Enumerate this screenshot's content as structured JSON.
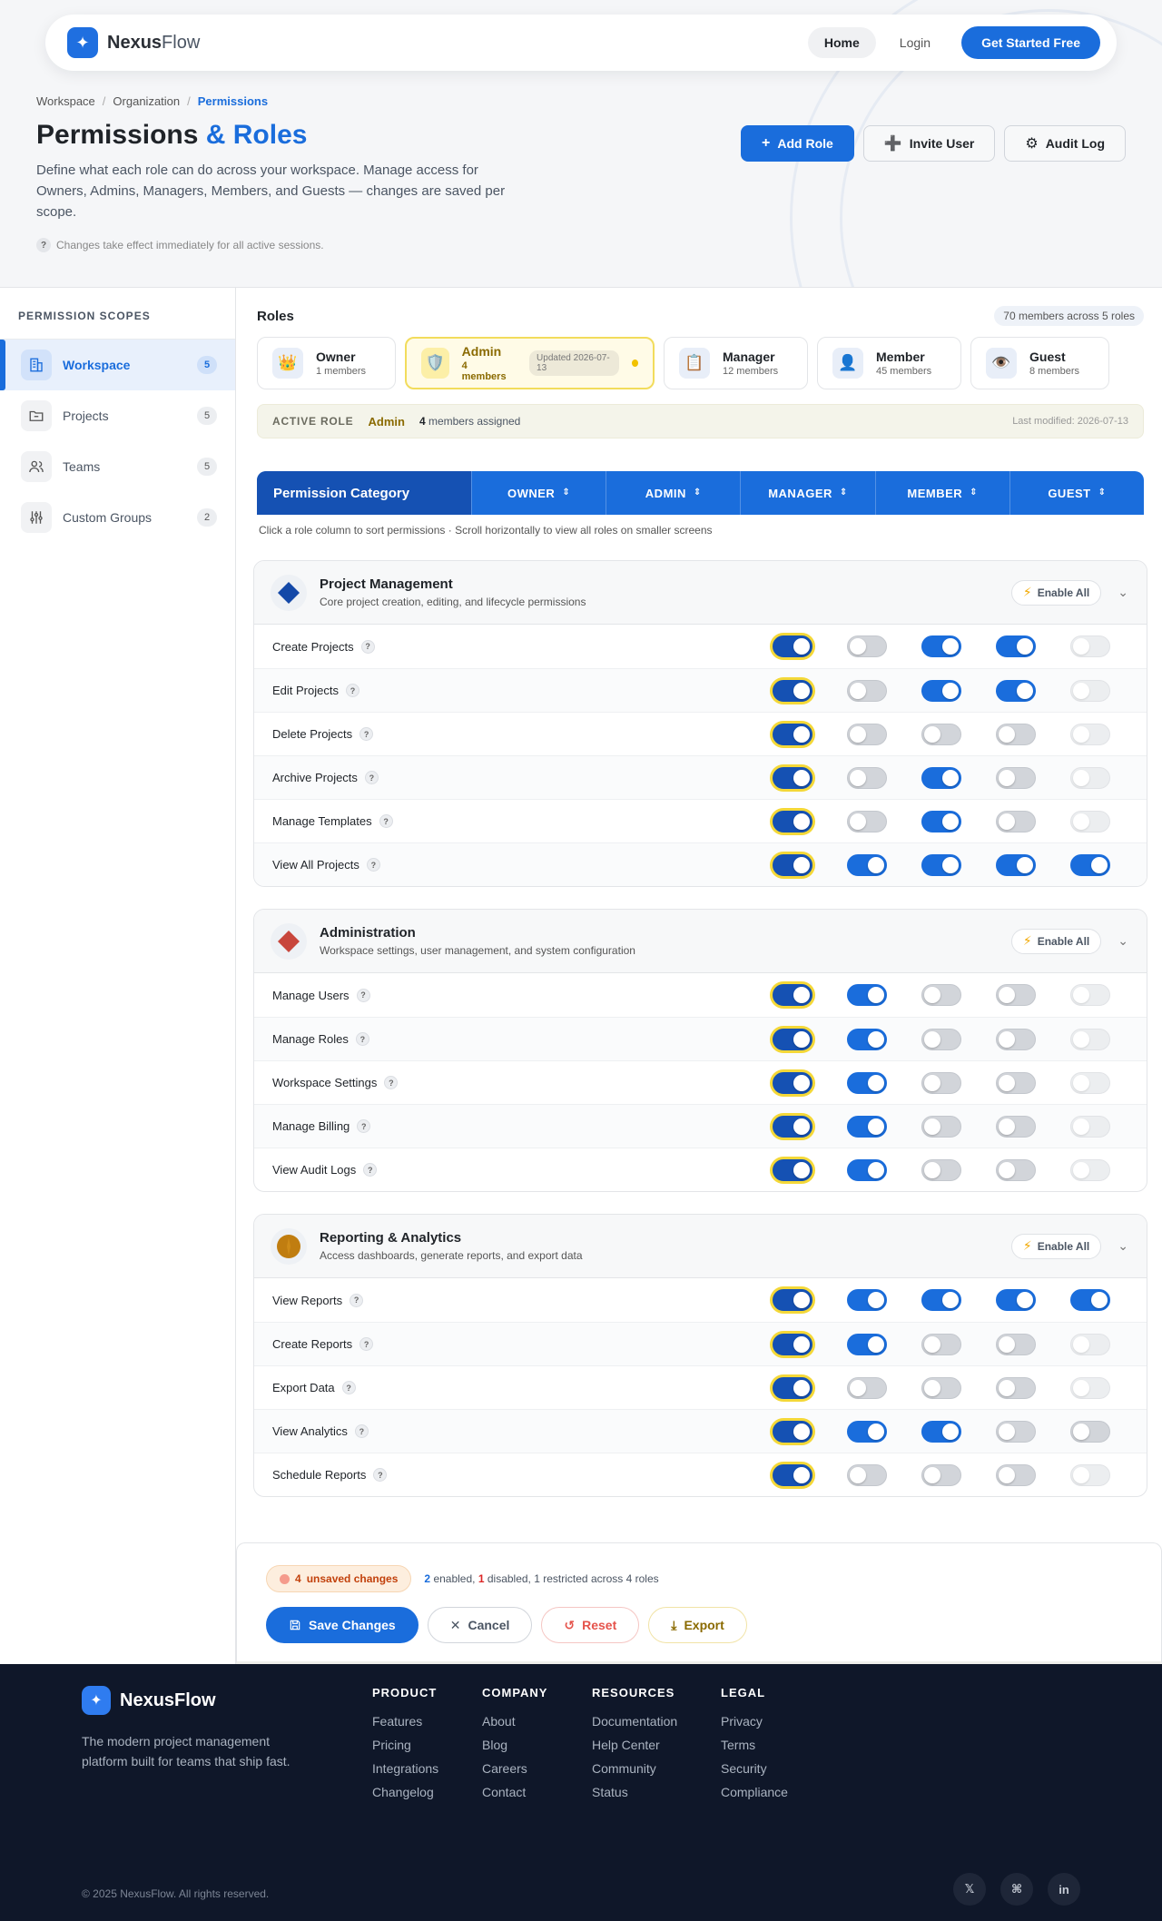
{
  "brand": {
    "name_a": "Nexus",
    "name_b": "Flow",
    "logo_glyph": "✦"
  },
  "nav": {
    "home": "Home",
    "login": "Login",
    "cta": "Get Started Free"
  },
  "breadcrumb": {
    "items": [
      "Workspace",
      "Organization"
    ],
    "current": "Permissions",
    "separator": "/"
  },
  "page": {
    "title_main": "Permissions",
    "title_accent": "& Roles",
    "description": "Define what each role can do across your workspace. Manage access for Owners, Admins, Managers, Members, and Guests — changes are saved per scope.",
    "note": "Changes take effect immediately for all active sessions."
  },
  "actions": {
    "add_role": "Add Role",
    "invite_user": "Invite User",
    "audit_log": "Audit Log"
  },
  "sidebar": {
    "heading": "PERMISSION SCOPES",
    "items": [
      {
        "label": "Workspace",
        "count": "5",
        "icon": "building-icon"
      },
      {
        "label": "Projects",
        "count": "5",
        "icon": "folder-icon"
      },
      {
        "label": "Teams",
        "count": "5",
        "icon": "users-icon"
      },
      {
        "label": "Custom Groups",
        "count": "2",
        "icon": "sliders-icon"
      }
    ]
  },
  "roles": {
    "title": "Roles",
    "summary": "70 members across 5 roles",
    "cards": [
      {
        "name": "Owner",
        "count": "1 members",
        "emoji": "👑"
      },
      {
        "name": "Admin",
        "count": "4 members",
        "emoji": "🛡️",
        "updated": "Updated 2026-07-13"
      },
      {
        "name": "Manager",
        "count": "12 members",
        "emoji": "📋"
      },
      {
        "name": "Member",
        "count": "45 members",
        "emoji": "👤"
      },
      {
        "name": "Guest",
        "count": "8 members",
        "emoji": "👁️"
      }
    ]
  },
  "active_role": {
    "label": "ACTIVE ROLE",
    "name": "Admin",
    "count": "4",
    "count_suffix": "members assigned",
    "modified": "Last modified: 2026-07-13"
  },
  "perm_header": {
    "category": "Permission Category",
    "columns": [
      "OWNER",
      "ADMIN",
      "MANAGER",
      "MEMBER",
      "GUEST"
    ],
    "hint": "Click a role column to sort permissions · Scroll horizontally to view all roles on smaller screens"
  },
  "enable_all_label": "Enable All",
  "groups": [
    {
      "title": "Project Management",
      "desc": "Core project creation, editing, and lifecycle permissions",
      "icon": "diamond-blue-icon",
      "rows": [
        {
          "label": "Create Projects",
          "states": [
            "owner",
            "off",
            "on",
            "on",
            "dim"
          ]
        },
        {
          "label": "Edit Projects",
          "states": [
            "owner",
            "off",
            "on",
            "on",
            "dim"
          ]
        },
        {
          "label": "Delete Projects",
          "states": [
            "owner",
            "off",
            "off",
            "off",
            "dim"
          ]
        },
        {
          "label": "Archive Projects",
          "states": [
            "owner",
            "off",
            "on",
            "off",
            "dim"
          ]
        },
        {
          "label": "Manage Templates",
          "states": [
            "owner",
            "off",
            "on",
            "off",
            "dim"
          ]
        },
        {
          "label": "View All Projects",
          "states": [
            "owner",
            "on",
            "on",
            "on",
            "on"
          ]
        }
      ]
    },
    {
      "title": "Administration",
      "desc": "Workspace settings, user management, and system configuration",
      "icon": "diamond-red-icon",
      "rows": [
        {
          "label": "Manage Users",
          "states": [
            "owner",
            "on",
            "off",
            "off",
            "dim"
          ]
        },
        {
          "label": "Manage Roles",
          "states": [
            "owner",
            "on",
            "off",
            "off",
            "dim"
          ]
        },
        {
          "label": "Workspace Settings",
          "states": [
            "owner",
            "on",
            "off",
            "off",
            "dim"
          ]
        },
        {
          "label": "Manage Billing",
          "states": [
            "owner",
            "on",
            "off",
            "off",
            "dim"
          ]
        },
        {
          "label": "View Audit Logs",
          "states": [
            "owner",
            "on",
            "off",
            "off",
            "dim"
          ]
        }
      ]
    },
    {
      "title": "Reporting & Analytics",
      "desc": "Access dashboards, generate reports, and export data",
      "icon": "circle-gold-icon",
      "rows": [
        {
          "label": "View Reports",
          "states": [
            "owner",
            "on",
            "on",
            "on",
            "on"
          ]
        },
        {
          "label": "Create Reports",
          "states": [
            "owner",
            "on",
            "off",
            "off",
            "dim"
          ]
        },
        {
          "label": "Export Data",
          "states": [
            "owner",
            "off",
            "off",
            "off",
            "dim"
          ]
        },
        {
          "label": "View Analytics",
          "states": [
            "owner",
            "on",
            "on",
            "off",
            "off"
          ]
        },
        {
          "label": "Schedule Reports",
          "states": [
            "owner",
            "off",
            "off",
            "off",
            "dim"
          ]
        }
      ]
    }
  ],
  "save_bar": {
    "unsaved_count": "4",
    "unsaved_label": "unsaved changes",
    "enabled": "2",
    "enabled_label": "enabled,",
    "disabled": "1",
    "disabled_label": "disabled,",
    "restricted_text": "1 restricted across 4 roles",
    "save": "Save Changes",
    "cancel": "Cancel",
    "reset": "Reset",
    "export": "Export"
  },
  "footer": {
    "brand": "NexusFlow",
    "tagline": "The modern project management platform built for teams that ship fast.",
    "columns": [
      {
        "title": "PRODUCT",
        "links": [
          "Features",
          "Pricing",
          "Integrations",
          "Changelog"
        ]
      },
      {
        "title": "COMPANY",
        "links": [
          "About",
          "Blog",
          "Careers",
          "Contact"
        ]
      },
      {
        "title": "RESOURCES",
        "links": [
          "Documentation",
          "Help Center",
          "Community",
          "Status"
        ]
      },
      {
        "title": "LEGAL",
        "links": [
          "Privacy",
          "Terms",
          "Security",
          "Compliance"
        ]
      }
    ],
    "copyright": "© 2025 NexusFlow. All rights reserved.",
    "social": [
      "𝕏",
      "⌘",
      "in"
    ]
  },
  "colors": {
    "accent": "#1a6ddc",
    "owner_ring": "#f4d838",
    "footer_bg": "#0f1729"
  }
}
